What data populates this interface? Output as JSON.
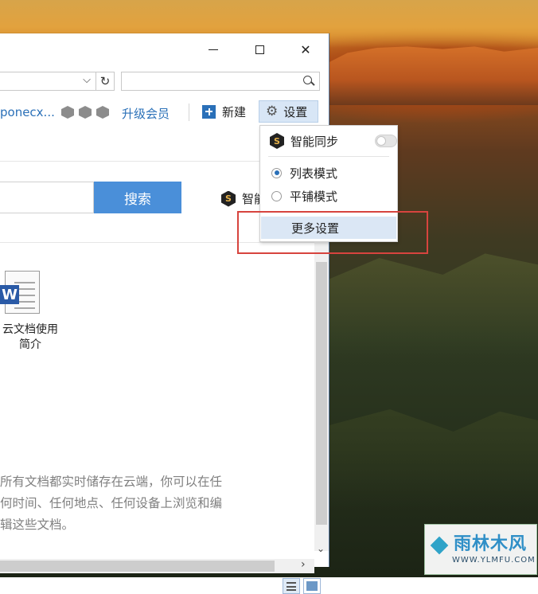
{
  "window": {
    "controls": {
      "minimize": "minimize",
      "maximize": "maximize",
      "close": "close"
    }
  },
  "toolbar": {
    "user_name": "ponecx...",
    "upgrade_label": "升级会员",
    "new_label": "新建",
    "settings_label": "设置"
  },
  "search": {
    "button_label": "搜索",
    "smart_sync_partial": "智能"
  },
  "files": [
    {
      "name_line1": "云文档使用",
      "name_line2": "简介",
      "icon": "word-document-icon"
    }
  ],
  "info_text": {
    "line1": "所有文档都实时储存在云端，你可以在任",
    "line2": "何时间、任何地点、任何设备上浏览和编",
    "line3": "辑这些文档。"
  },
  "settings_menu": {
    "smart_sync_label": "智能同步",
    "smart_sync_on": false,
    "list_mode_label": "列表模式",
    "tile_mode_label": "平铺模式",
    "selected_mode": "list",
    "more_settings_label": "更多设置"
  },
  "watermark": {
    "title": "雨林木风",
    "url": "WWW.YLMFU.COM"
  },
  "colors": {
    "accent": "#2a70b8",
    "search_button": "#4a8fd9",
    "highlight_box": "#d7443e"
  }
}
